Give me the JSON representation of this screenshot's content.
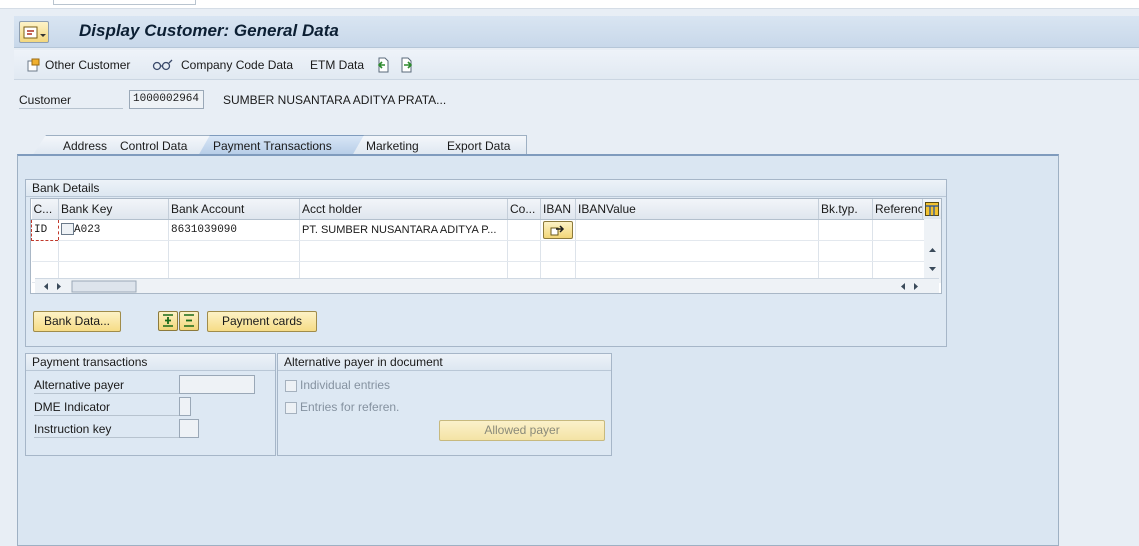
{
  "window": {
    "title": "Display Customer: General Data"
  },
  "toolbar": {
    "other_customer": "Other Customer",
    "company_code_data": "Company Code Data",
    "etm_data": "ETM Data"
  },
  "header": {
    "customer_label": "Customer",
    "customer_number": "1000002964",
    "customer_name": "SUMBER NUSANTARA ADITYA PRATA..."
  },
  "tabs": [
    {
      "label": "Address"
    },
    {
      "label": "Control Data"
    },
    {
      "label": "Payment Transactions",
      "selected": true
    },
    {
      "label": "Marketing"
    },
    {
      "label": "Export Data"
    }
  ],
  "bank_details": {
    "title": "Bank Details",
    "columns": [
      "C...",
      "Bank Key",
      "Bank Account",
      "Acct holder",
      "Co...",
      "IBAN",
      "IBANValue",
      "Bk.typ.",
      "Referenc"
    ],
    "rows": [
      {
        "country": "ID",
        "bank_key": "A023",
        "bank_account": "8631039090",
        "acct_holder": "PT. SUMBER NUSANTARA ADITYA P...",
        "co": "",
        "iban_value": "",
        "bk_typ": "",
        "reference": ""
      }
    ],
    "bank_data_button": "Bank Data...",
    "payment_cards_button": "Payment cards"
  },
  "payment_transactions": {
    "title": "Payment transactions",
    "alternative_payer": "Alternative payer",
    "dme_indicator": "DME Indicator",
    "instruction_key": "Instruction key"
  },
  "alt_payer_doc": {
    "title": "Alternative payer in document",
    "individual_entries": "Individual entries",
    "entries_for_reference": "Entries for referen.",
    "allowed_payer_button": "Allowed payer"
  },
  "colors": {
    "accent": "#7f9bbd",
    "button": "#f6dc86",
    "background": "#e8eef5"
  }
}
